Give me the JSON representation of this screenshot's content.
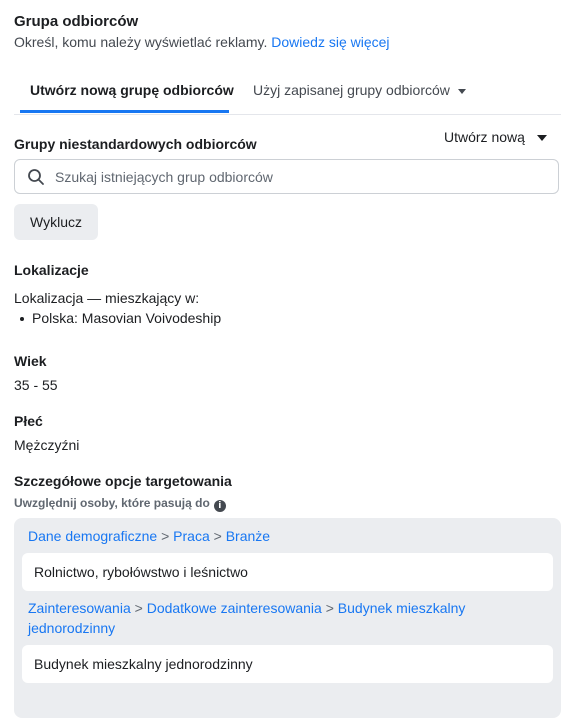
{
  "header": {
    "title": "Grupa odbiorców",
    "subtitle": "Określ, komu należy wyświetlać reklamy.",
    "learn_more": "Dowiedz się więcej"
  },
  "tabs": [
    {
      "label": "Utwórz nową grupę odbiorców",
      "active": true
    },
    {
      "label": "Użyj zapisanej grupy odbiorców",
      "active": false
    }
  ],
  "custom_audiences": {
    "label": "Grupy niestandardowych odbiorców",
    "create_new": "Utwórz nową",
    "search_placeholder": "Szukaj istniejących grup odbiorców",
    "exclude_button": "Wyklucz"
  },
  "locations": {
    "label": "Lokalizacje",
    "type": "Lokalizacja — mieszkający w:",
    "items": [
      "Polska: Masovian Voivodeship"
    ]
  },
  "age": {
    "label": "Wiek",
    "value": "35 - 55"
  },
  "gender": {
    "label": "Płeć",
    "value": "Mężczyźni"
  },
  "detailed_targeting": {
    "label": "Szczegółowe opcje targetowania",
    "hint": "Uwzględnij osoby, które pasują do",
    "groups": [
      {
        "path": [
          "Dane demograficzne",
          "Praca",
          "Branże"
        ],
        "item": "Rolnictwo, rybołówstwo i leśnictwo"
      },
      {
        "path": [
          "Zainteresowania",
          "Dodatkowe zainteresowania",
          "Budynek mieszkalny jednorodzinny"
        ],
        "item": "Budynek mieszkalny jednorodzinny"
      }
    ]
  },
  "colors": {
    "accent": "#1877f2",
    "panel": "#ebedf0",
    "text": "#1c1e21"
  },
  "icons": {
    "search": "search-icon",
    "info": "info-icon",
    "dropdown": "caret-down-icon"
  }
}
